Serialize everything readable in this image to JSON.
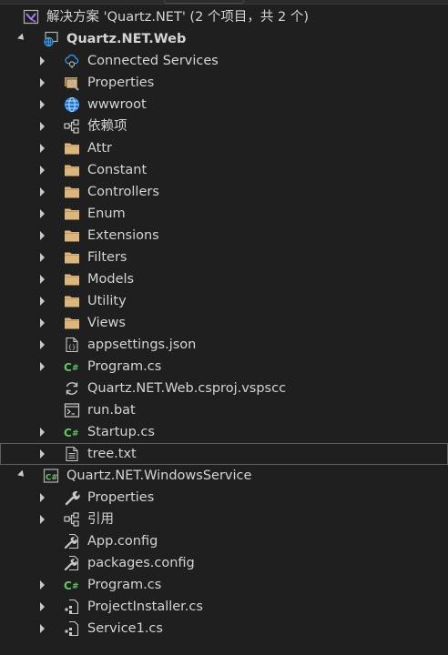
{
  "solution": {
    "label": "解决方案 'Quartz.NET' (2 个项目，共 2 个)"
  },
  "projects": [
    {
      "label": "Quartz.NET.Web",
      "items": [
        {
          "label": "Connected Services",
          "icon": "connected-services-icon"
        },
        {
          "label": "Properties",
          "icon": "properties-icon"
        },
        {
          "label": "wwwroot",
          "icon": "globe-icon"
        },
        {
          "label": "依赖项",
          "icon": "dependencies-icon"
        },
        {
          "label": "Attr",
          "icon": "folder-icon"
        },
        {
          "label": "Constant",
          "icon": "folder-icon"
        },
        {
          "label": "Controllers",
          "icon": "folder-icon"
        },
        {
          "label": "Enum",
          "icon": "folder-icon"
        },
        {
          "label": "Extensions",
          "icon": "folder-icon"
        },
        {
          "label": "Filters",
          "icon": "folder-icon"
        },
        {
          "label": "Models",
          "icon": "folder-icon"
        },
        {
          "label": "Utility",
          "icon": "folder-icon"
        },
        {
          "label": "Views",
          "icon": "folder-icon"
        },
        {
          "label": "appsettings.json",
          "icon": "json-file-icon"
        },
        {
          "label": "Program.cs",
          "icon": "csharp-file-icon"
        },
        {
          "label": "Quartz.NET.Web.csproj.vspscc",
          "icon": "sync-icon"
        },
        {
          "label": "run.bat",
          "icon": "batch-file-icon"
        },
        {
          "label": "Startup.cs",
          "icon": "csharp-file-icon"
        },
        {
          "label": "tree.txt",
          "icon": "text-file-icon"
        }
      ]
    },
    {
      "label": "Quartz.NET.WindowsService",
      "items": [
        {
          "label": "Properties",
          "icon": "wrench-icon"
        },
        {
          "label": "引用",
          "icon": "references-icon"
        },
        {
          "label": "App.config",
          "icon": "config-file-icon"
        },
        {
          "label": "packages.config",
          "icon": "config-file-icon"
        },
        {
          "label": "Program.cs",
          "icon": "csharp-file-icon"
        },
        {
          "label": "ProjectInstaller.cs",
          "icon": "component-file-icon"
        },
        {
          "label": "Service1.cs",
          "icon": "component-file-icon"
        }
      ]
    }
  ],
  "selected_item": "tree.txt",
  "colors": {
    "background": "#1f1f1f",
    "text": "#d4d4d4",
    "folder": "#dcb67a",
    "csharp": "#68c268",
    "vs_purple": "#a97cf3",
    "globe": "#3c9bf0",
    "selection_border": "#5f5f5f"
  }
}
